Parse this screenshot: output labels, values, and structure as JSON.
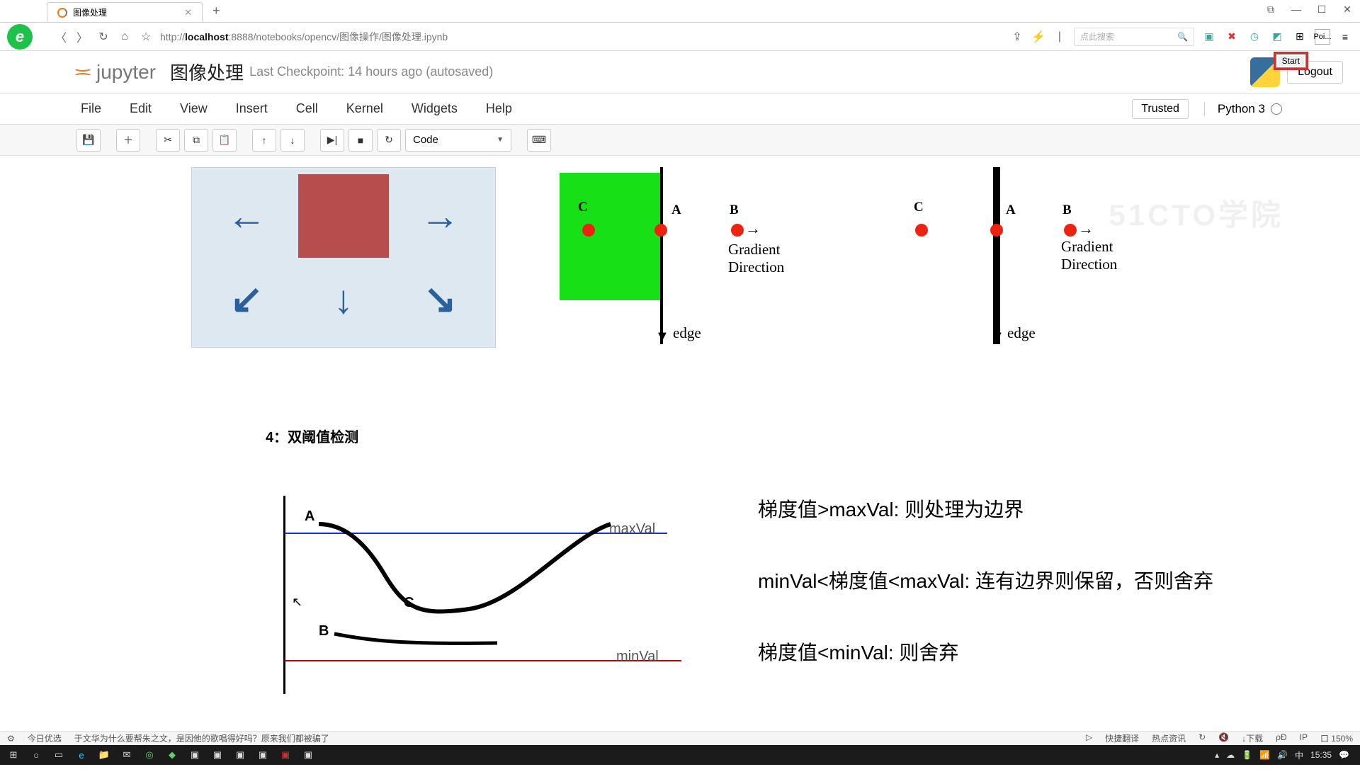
{
  "browser": {
    "tab_title": "图像处理",
    "url_prefix": "http://",
    "url_host": "localhost",
    "url_rest": ":8888/notebooks/opencv/图像操作/图像处理.ipynb",
    "search_placeholder": "点此搜索"
  },
  "jupyter": {
    "logo_text": "jupyter",
    "nb_title": "图像处理",
    "checkpoint": "Last Checkpoint: 14 hours ago (autosaved)",
    "logout": "Logout",
    "trusted": "Trusted",
    "kernel": "Python 3",
    "menus": [
      "File",
      "Edit",
      "View",
      "Insert",
      "Cell",
      "Kernel",
      "Widgets",
      "Help"
    ],
    "cell_type": "Code"
  },
  "content": {
    "grad_dir": "Gradient Direction",
    "edge_lbl": "edge",
    "labels": {
      "A": "A",
      "B": "B",
      "C": "C"
    },
    "section4": "4：双阈值检测",
    "maxval": "maxVal",
    "minval": "minVal",
    "rule1": "梯度值>maxVal: 则处理为边界",
    "rule2": "minVal<梯度值<maxVal: 连有边界则保留，否则舍弃",
    "rule3": "梯度值<minVal: 则舍弃"
  },
  "overlay": {
    "start": "Start",
    "poi": "Poi..."
  },
  "status": {
    "left1": "今日优选",
    "left2": "于文华为什么要帮朱之文，是因他的歌唱得好吗？原来我们都被骗了",
    "r1": "快捷翻译",
    "r2": "热点资讯",
    "r3": "↓下载",
    "r4": "ρÐ",
    "r5": "口 150%"
  },
  "taskbar": {
    "time": "15:35"
  }
}
